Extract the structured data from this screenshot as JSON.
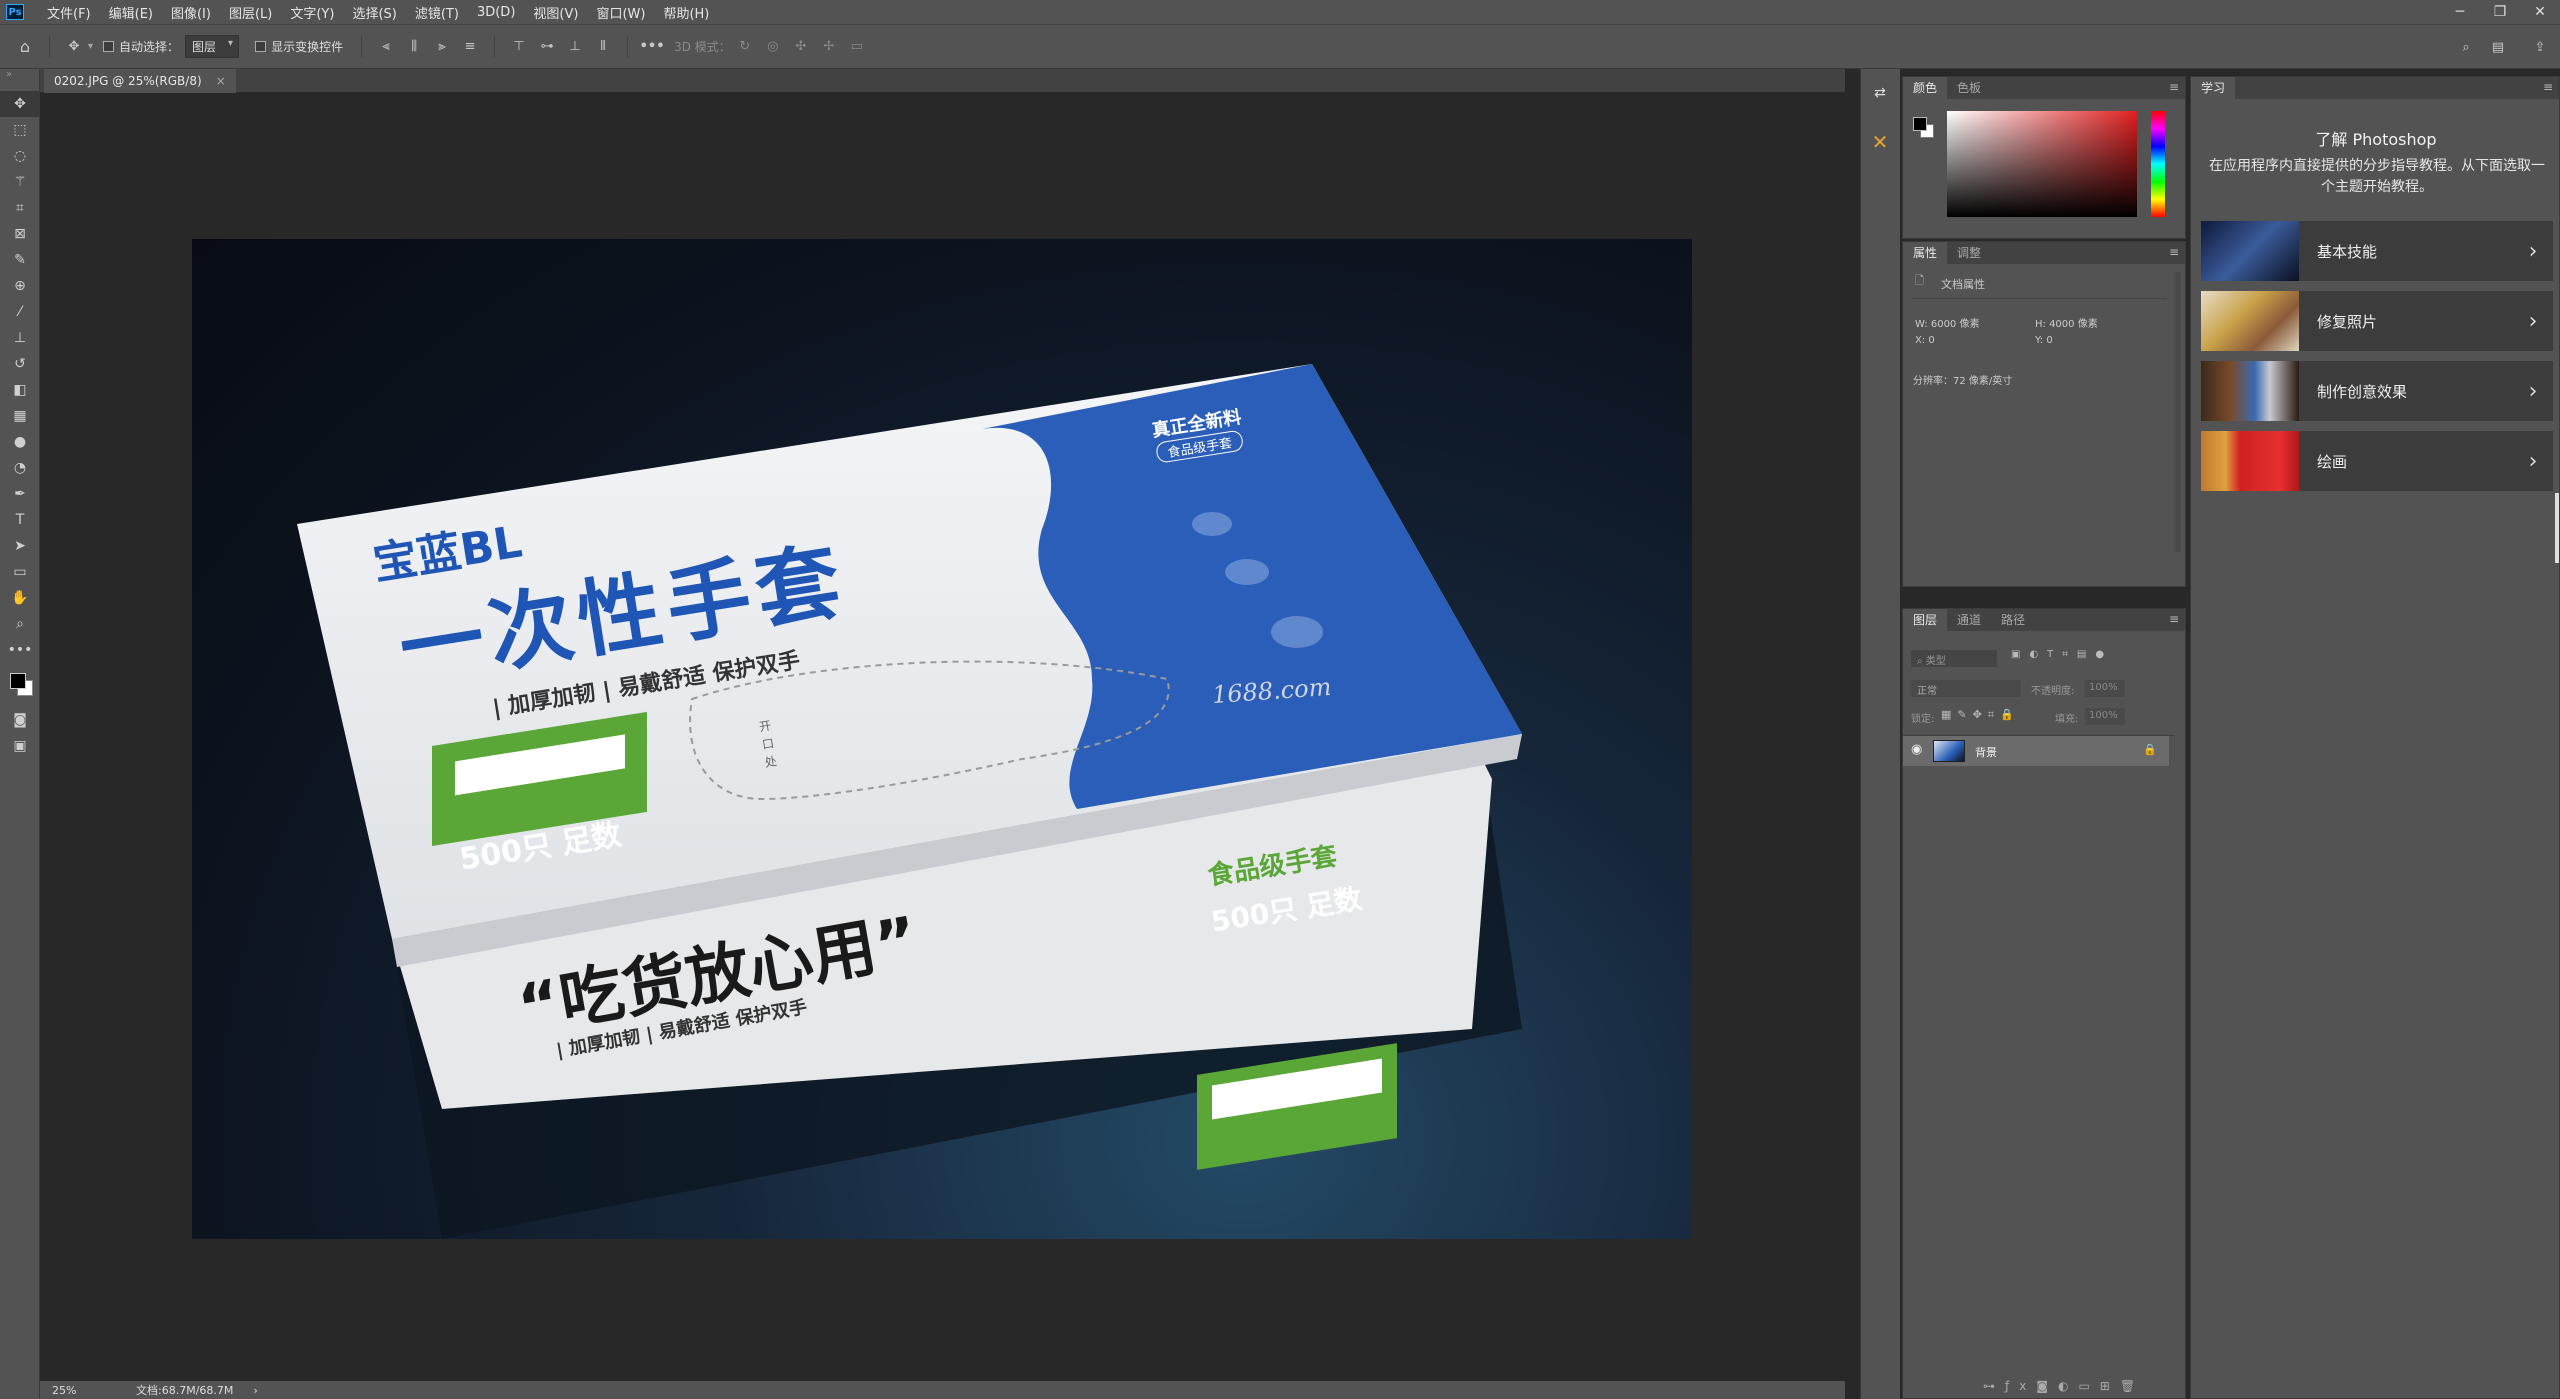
{
  "app": {
    "logo": "Ps"
  },
  "menu": [
    "文件(F)",
    "编辑(E)",
    "图像(I)",
    "图层(L)",
    "文字(Y)",
    "选择(S)",
    "滤镜(T)",
    "3D(D)",
    "视图(V)",
    "窗口(W)",
    "帮助(H)"
  ],
  "options": {
    "auto_select_label": "自动选择：",
    "auto_select_value": "图层",
    "show_transform_label": "显示变换控件",
    "mode_3d_label": "3D 模式："
  },
  "document": {
    "tab_title": "0202.JPG @ 25%(RGB/8)",
    "close": "×"
  },
  "status": {
    "zoom": "25%",
    "doc_size": "文档:68.7M/68.7M",
    "arrow": "›"
  },
  "artwork": {
    "brand": "宝蓝BL",
    "product": "一次性手套",
    "tagline": "| 加厚加韧 | 易戴舒适 保护双手",
    "badge_top": "真正全新料",
    "badge_sub": "食品级手套",
    "open_text": "开口处",
    "watermark": "1688.com",
    "green1_l1": "食品级手套",
    "green1_l2": "500只 足数",
    "green2_l1": "食品级手套",
    "green2_l2": "500只 足数",
    "slogan": "“吃货放心用”",
    "tagline2": "| 加厚加韧 | 易戴舒适 保护双手"
  },
  "color_panel": {
    "tabs": [
      "颜色",
      "色板"
    ],
    "fg": "#000000",
    "bg": "#ffffff",
    "hue": "#e02020"
  },
  "props_panel": {
    "tabs": [
      "属性",
      "调整"
    ],
    "title": "文档属性",
    "w": "W:  6000 像素",
    "h": "H:  4000 像素",
    "x": "X:  0",
    "y": "Y:  0",
    "resolution": "分辨率：72 像素/英寸"
  },
  "layers_panel": {
    "tabs": [
      "图层",
      "通道",
      "路径"
    ],
    "filter": "类型",
    "blend": "正常",
    "opacity_label": "不透明度:",
    "opacity": "100%",
    "lock_label": "锁定:",
    "fill_label": "填充:",
    "fill": "100%",
    "layer_name": "背景"
  },
  "learn": {
    "tab": "学习",
    "title": "了解 Photoshop",
    "desc": "在应用程序内直接提供的分步指导教程。从下面选取一个主题开始教程。",
    "items": [
      "基本技能",
      "修复照片",
      "制作创意效果",
      "绘画"
    ]
  }
}
